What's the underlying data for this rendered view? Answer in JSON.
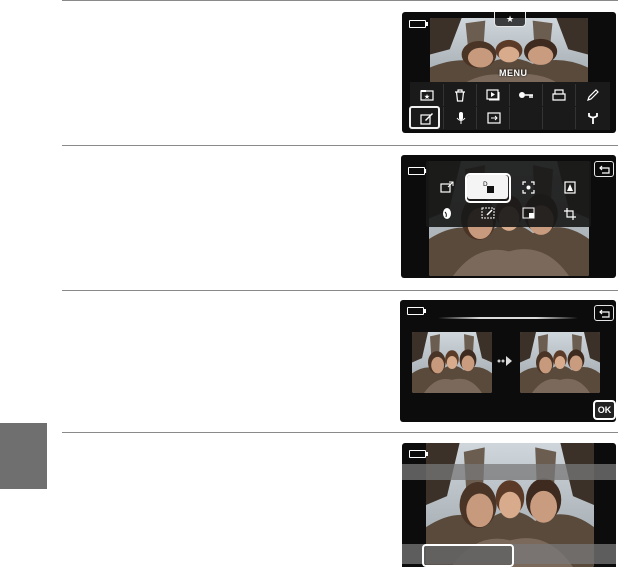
{
  "page": {
    "colors": {
      "side_tab": "#6f6f6f",
      "rule": "#8a8a8a",
      "screen_bg": "#0c0c0c"
    }
  },
  "screen1": {
    "star_label": "★",
    "menu_label": "MENU",
    "icons_row1": [
      "favorites-icon",
      "trash-icon",
      "slideshow-icon",
      "protect-key-icon",
      "print-icon",
      "pencil-icon"
    ],
    "icons_row2": [
      "edit-icon",
      "voice-memo-icon",
      "copy-icon",
      "",
      "",
      "setup-wrench-icon"
    ],
    "selected_icon": "edit-icon"
  },
  "screen2": {
    "grid_icons": [
      "quick-retouch-icon",
      "d-lighting-icon",
      "skin-softening-icon",
      "filter-effects-icon",
      "glamour-retouch-icon",
      "photo-frame-icon",
      "small-picture-icon",
      "crop-icon"
    ],
    "selected_icon": "d-lighting-icon"
  },
  "screen3": {
    "ok_label": "OK"
  },
  "screen4": {}
}
